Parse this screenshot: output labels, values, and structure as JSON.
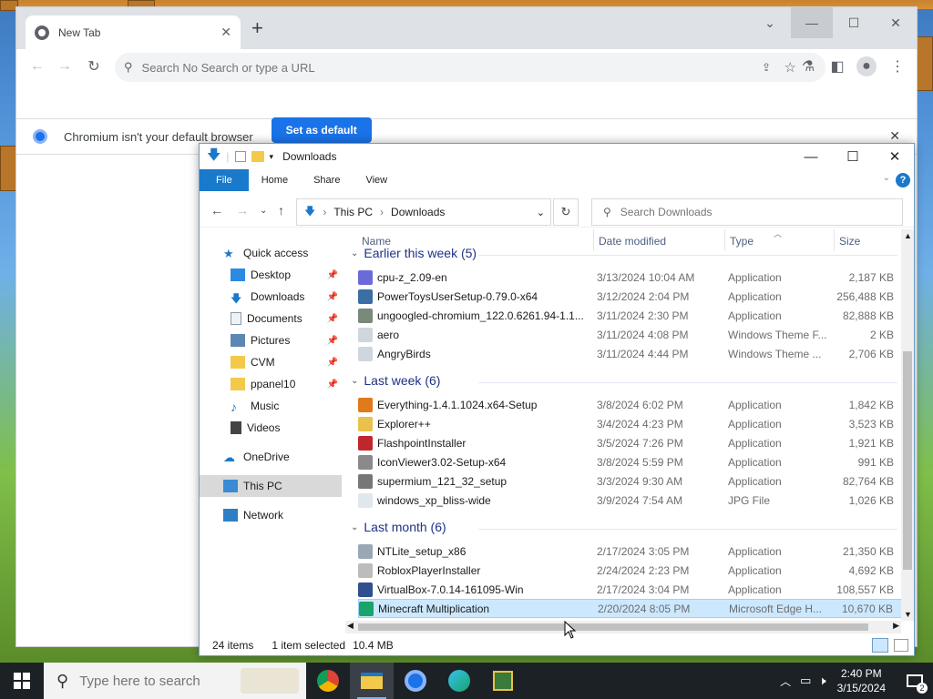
{
  "browser": {
    "tab_title": "New Tab",
    "omnibox_placeholder": "Search No Search or type a URL",
    "infobar_text": "Chromium isn't your default browser",
    "set_default_label": "Set as default"
  },
  "explorer": {
    "title": "Downloads",
    "ribbon_tabs": [
      "File",
      "Home",
      "Share",
      "View"
    ],
    "breadcrumb": [
      "This PC",
      "Downloads"
    ],
    "search_placeholder": "Search Downloads",
    "nav": {
      "quick_access": "Quick access",
      "items": [
        {
          "label": "Desktop",
          "icon": "desktop-icon",
          "pinned": true
        },
        {
          "label": "Downloads",
          "icon": "downloads-icon",
          "pinned": true
        },
        {
          "label": "Documents",
          "icon": "documents-icon",
          "pinned": true
        },
        {
          "label": "Pictures",
          "icon": "pictures-icon",
          "pinned": true
        },
        {
          "label": "CVM",
          "icon": "folder-icon",
          "pinned": true
        },
        {
          "label": "ppanel10",
          "icon": "folder-icon",
          "pinned": true
        },
        {
          "label": "Music",
          "icon": "music-icon",
          "pinned": false
        },
        {
          "label": "Videos",
          "icon": "videos-icon",
          "pinned": false
        }
      ],
      "onedrive": "OneDrive",
      "this_pc": "This PC",
      "network": "Network"
    },
    "columns": {
      "name": "Name",
      "date": "Date modified",
      "type": "Type",
      "size": "Size"
    },
    "groups": [
      {
        "title": "Earlier this week (5)",
        "rows": [
          {
            "name": "cpu-z_2.09-en",
            "date": "3/13/2024 10:04 AM",
            "type": "Application",
            "size": "2,187 KB",
            "color": "#6b6bd8"
          },
          {
            "name": "PowerToysUserSetup-0.79.0-x64",
            "date": "3/12/2024 2:04 PM",
            "type": "Application",
            "size": "256,488 KB",
            "color": "#3a6ea5"
          },
          {
            "name": "ungoogled-chromium_122.0.6261.94-1.1...",
            "date": "3/11/2024 2:30 PM",
            "type": "Application",
            "size": "82,888 KB",
            "color": "#7a8a7a"
          },
          {
            "name": "aero",
            "date": "3/11/2024 4:08 PM",
            "type": "Windows Theme F...",
            "size": "2 KB",
            "color": "#cfd6de"
          },
          {
            "name": "AngryBirds",
            "date": "3/11/2024 4:44 PM",
            "type": "Windows Theme ...",
            "size": "2,706 KB",
            "color": "#cfd6de"
          }
        ]
      },
      {
        "title": "Last week (6)",
        "rows": [
          {
            "name": "Everything-1.4.1.1024.x64-Setup",
            "date": "3/8/2024 6:02 PM",
            "type": "Application",
            "size": "1,842 KB",
            "color": "#e07a1a"
          },
          {
            "name": "Explorer++",
            "date": "3/4/2024 4:23 PM",
            "type": "Application",
            "size": "3,523 KB",
            "color": "#e8c24a"
          },
          {
            "name": "FlashpointInstaller",
            "date": "3/5/2024 7:26 PM",
            "type": "Application",
            "size": "1,921 KB",
            "color": "#c0272d"
          },
          {
            "name": "IconViewer3.02-Setup-x64",
            "date": "3/8/2024 5:59 PM",
            "type": "Application",
            "size": "991 KB",
            "color": "#8a8a8a"
          },
          {
            "name": "supermium_121_32_setup",
            "date": "3/3/2024 9:30 AM",
            "type": "Application",
            "size": "82,764 KB",
            "color": "#777777"
          },
          {
            "name": "windows_xp_bliss-wide",
            "date": "3/9/2024 7:54 AM",
            "type": "JPG File",
            "size": "1,026 KB",
            "color": "#dfe7ef"
          }
        ]
      },
      {
        "title": "Last month (6)",
        "rows": [
          {
            "name": "NTLite_setup_x86",
            "date": "2/17/2024 3:05 PM",
            "type": "Application",
            "size": "21,350 KB",
            "color": "#9aa8b6"
          },
          {
            "name": "RobloxPlayerInstaller",
            "date": "2/24/2024 2:23 PM",
            "type": "Application",
            "size": "4,692 KB",
            "color": "#bcbcbc"
          },
          {
            "name": "VirtualBox-7.0.14-161095-Win",
            "date": "2/17/2024 3:04 PM",
            "type": "Application",
            "size": "108,557 KB",
            "color": "#2f4f8f"
          },
          {
            "name": "Minecraft Multiplication",
            "date": "2/20/2024 8:05 PM",
            "type": "Microsoft Edge H...",
            "size": "10,670 KB",
            "color": "#1aa36a",
            "selected": true
          }
        ]
      }
    ],
    "status": {
      "items": "24 items",
      "selected": "1 item selected",
      "selected_size": "10.4 MB"
    }
  },
  "taskbar": {
    "search_placeholder": "Type here to search",
    "time": "2:40 PM",
    "date": "3/15/2024",
    "notification_count": "2"
  }
}
